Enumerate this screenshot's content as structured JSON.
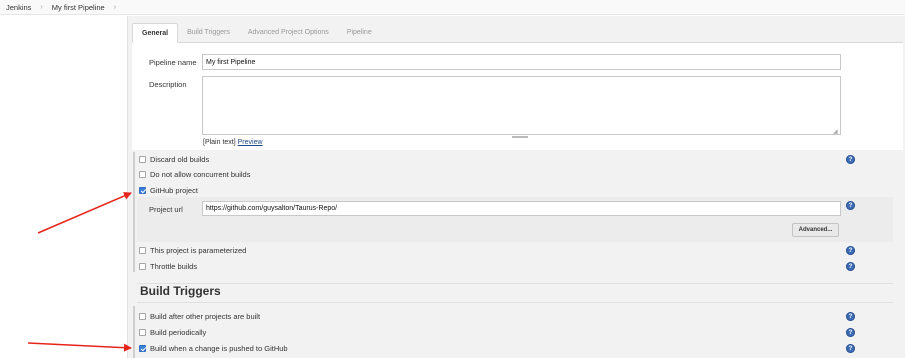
{
  "breadcrumb": {
    "items": [
      "Jenkins",
      "My first Pipeline"
    ],
    "separator": "›"
  },
  "tabs": [
    {
      "label": "General",
      "active": true
    },
    {
      "label": "Build Triggers",
      "active": false
    },
    {
      "label": "Advanced Project Options",
      "active": false
    },
    {
      "label": "Pipeline",
      "active": false
    }
  ],
  "general": {
    "pipeline_name_label": "Pipeline name",
    "pipeline_name_value": "My first Pipeline",
    "description_label": "Description",
    "description_value": "",
    "plain_text": "[Plain text]",
    "preview_link": "Preview",
    "options": [
      {
        "label": "Discard old builds",
        "checked": false
      },
      {
        "label": "Do not allow concurrent builds",
        "checked": false
      },
      {
        "label": "GitHub project",
        "checked": true
      },
      {
        "label": "This project is parameterized",
        "checked": false
      },
      {
        "label": "Throttle builds",
        "checked": false
      }
    ],
    "project_url_label": "Project url",
    "project_url_value": "https://github.com/guysalton/Taurus-Repo/",
    "advanced_button": "Advanced..."
  },
  "build_triggers": {
    "heading": "Build Triggers",
    "options": [
      {
        "label": "Build after other projects are built",
        "checked": false
      },
      {
        "label": "Build periodically",
        "checked": false
      },
      {
        "label": "Build when a change is pushed to GitHub",
        "checked": true
      }
    ]
  },
  "help_icon_glyph": "?",
  "colors": {
    "arrow": "#e8231b",
    "help_icon": "#3f6db4",
    "checkbox_checked": "#3b7fd9",
    "link": "#204a87"
  }
}
